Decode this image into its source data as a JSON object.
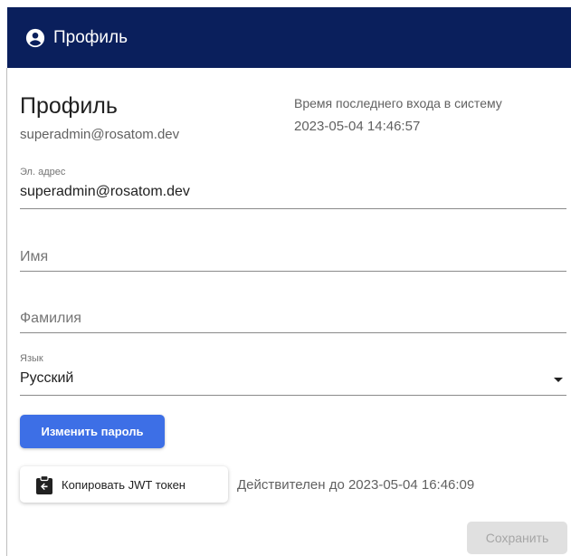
{
  "appbar": {
    "title": "Профиль",
    "icon": "account-circle-icon",
    "background": "#0a1f5c"
  },
  "profile": {
    "heading": "Профиль",
    "email": "superadmin@rosatom.dev",
    "last_login_label": "Время последнего входа в систему",
    "last_login_value": "2023-05-04 14:46:57"
  },
  "form": {
    "email": {
      "label": "Эл. адрес",
      "value": "superadmin@rosatom.dev"
    },
    "first_name": {
      "placeholder": "Имя",
      "value": ""
    },
    "last_name": {
      "placeholder": "Фамилия",
      "value": ""
    },
    "language": {
      "label": "Язык",
      "value": "Русский"
    }
  },
  "actions": {
    "change_password": "Изменить пароль",
    "copy_jwt": "Копировать JWT токен",
    "copy_icon": "clipboard-icon",
    "jwt_valid_until": "Действителен до 2023-05-04 16:46:09",
    "save": "Сохранить"
  },
  "colors": {
    "primary": "#3d6fe6",
    "disabled_bg": "#e0e0e0",
    "disabled_text": "#a6a6a6"
  }
}
